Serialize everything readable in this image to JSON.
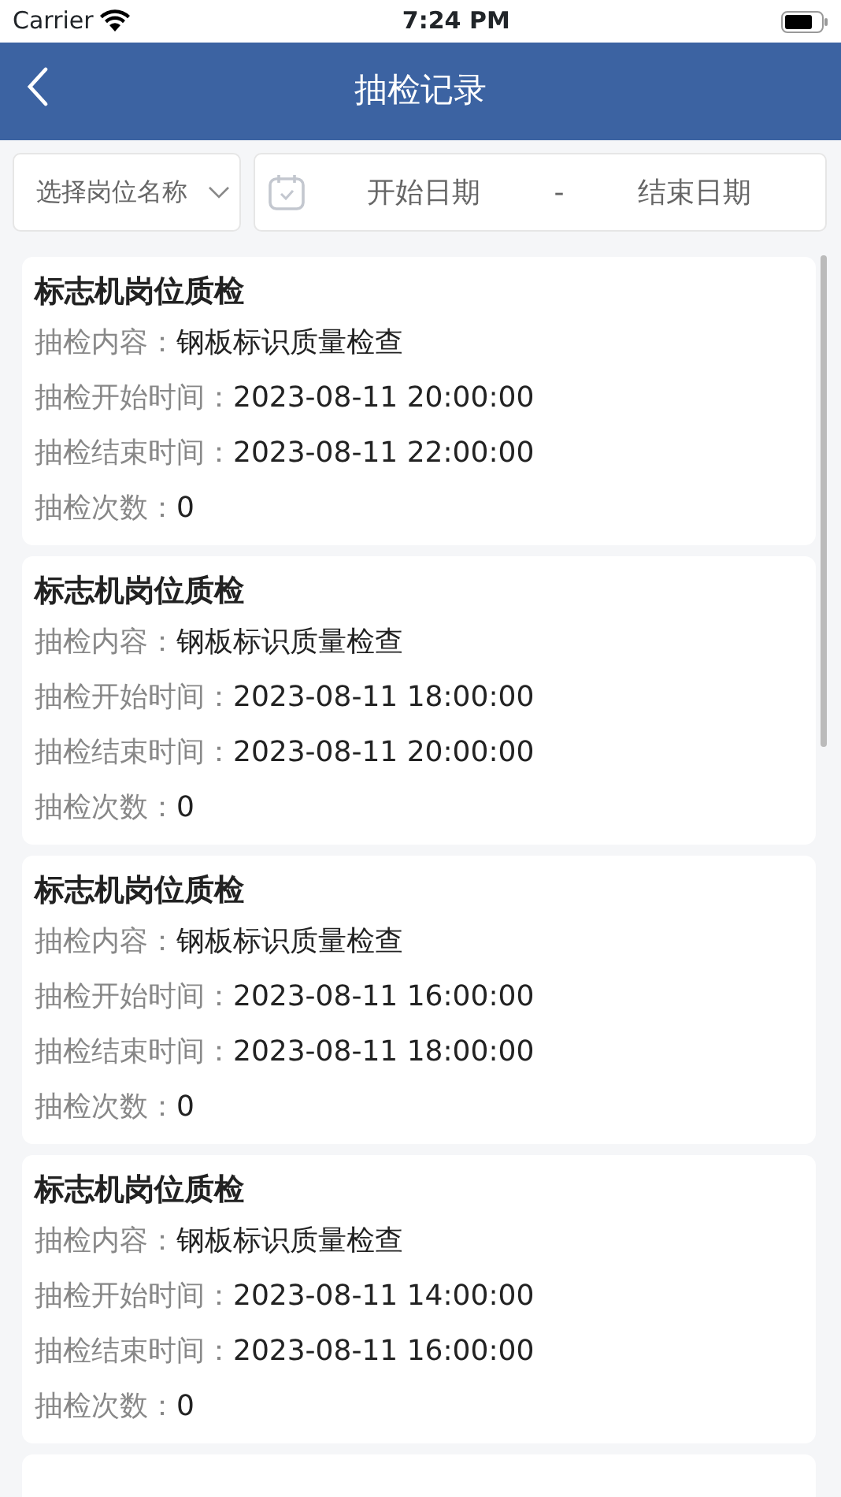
{
  "status_bar": {
    "carrier": "Carrier",
    "time": "7:24 PM"
  },
  "header": {
    "title": "抽检记录"
  },
  "filters": {
    "post_placeholder": "选择岗位名称",
    "start_placeholder": "开始日期",
    "separator": "-",
    "end_placeholder": "结束日期"
  },
  "records": [
    {
      "title": "标志机岗位质检",
      "fields": [
        {
          "label": "抽检内容：",
          "value": "钢板标识质量检查"
        },
        {
          "label": "抽检开始时间：",
          "value": "2023-08-11 20:00:00"
        },
        {
          "label": "抽检结束时间：",
          "value": "2023-08-11 22:00:00"
        },
        {
          "label": "抽检次数：",
          "value": "0"
        }
      ]
    },
    {
      "title": "标志机岗位质检",
      "fields": [
        {
          "label": "抽检内容：",
          "value": "钢板标识质量检查"
        },
        {
          "label": "抽检开始时间：",
          "value": "2023-08-11 18:00:00"
        },
        {
          "label": "抽检结束时间：",
          "value": "2023-08-11 20:00:00"
        },
        {
          "label": "抽检次数：",
          "value": "0"
        }
      ]
    },
    {
      "title": "标志机岗位质检",
      "fields": [
        {
          "label": "抽检内容：",
          "value": "钢板标识质量检查"
        },
        {
          "label": "抽检开始时间：",
          "value": "2023-08-11 16:00:00"
        },
        {
          "label": "抽检结束时间：",
          "value": "2023-08-11 18:00:00"
        },
        {
          "label": "抽检次数：",
          "value": "0"
        }
      ]
    },
    {
      "title": "标志机岗位质检",
      "fields": [
        {
          "label": "抽检内容：",
          "value": "钢板标识质量检查"
        },
        {
          "label": "抽检开始时间：",
          "value": "2023-08-11 14:00:00"
        },
        {
          "label": "抽检结束时间：",
          "value": "2023-08-11 16:00:00"
        },
        {
          "label": "抽检次数：",
          "value": "0"
        }
      ]
    }
  ]
}
